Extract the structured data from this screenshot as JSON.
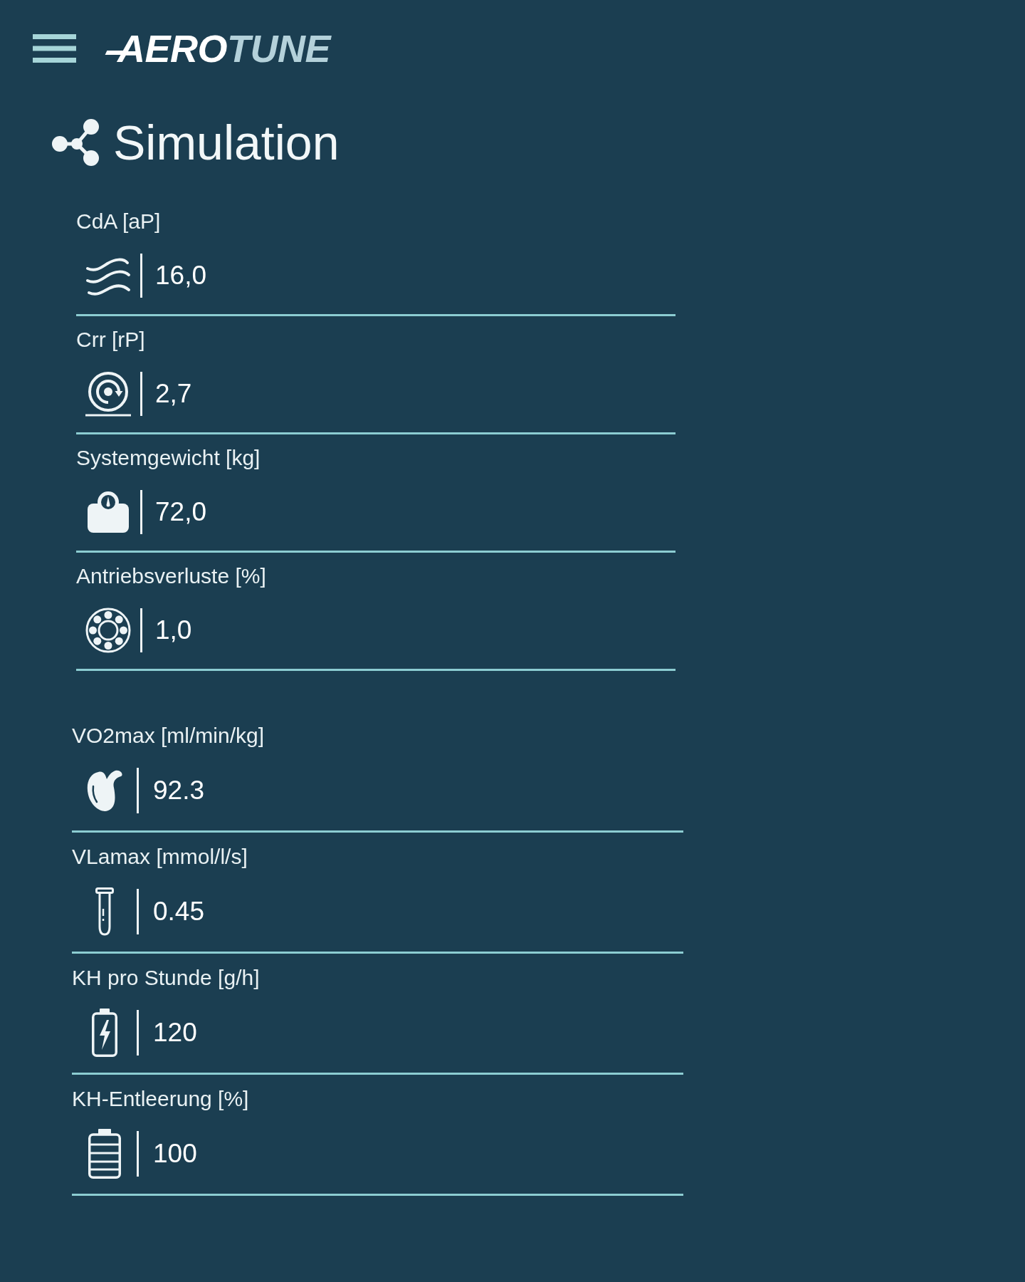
{
  "header": {
    "logo": {
      "primary": "AERO",
      "secondary": "TUNE"
    }
  },
  "page": {
    "title": "Simulation"
  },
  "groups": [
    {
      "fields": [
        {
          "kind": "drag",
          "label": "CdA [aP]",
          "value": "16,0"
        },
        {
          "kind": "rolling",
          "label": "Crr [rP]",
          "value": "2,7"
        },
        {
          "kind": "weight",
          "label": "Systemgewicht [kg]",
          "value": "72,0"
        },
        {
          "kind": "drivetrain",
          "label": "Antriebsverluste [%]",
          "value": "1,0"
        }
      ]
    },
    {
      "fields": [
        {
          "kind": "vo2max",
          "label": "VO2max [ml/min/kg]",
          "value": "92.3"
        },
        {
          "kind": "lactate",
          "label": "VLamax [mmol/l/s]",
          "value": "0.45"
        },
        {
          "kind": "carbs",
          "label": "KH pro Stunde [g/h]",
          "value": "120"
        },
        {
          "kind": "depletion",
          "label": "KH-Entleerung [%]",
          "value": "100"
        }
      ]
    }
  ]
}
